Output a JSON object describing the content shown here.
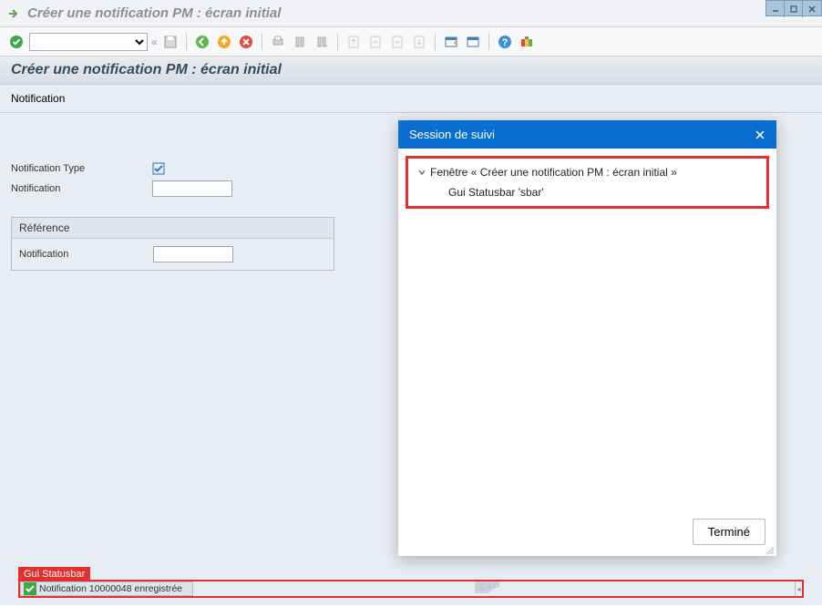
{
  "window": {
    "title": "Créer une notification PM : écran initial"
  },
  "page": {
    "header_title": "Créer une notification PM : écran initial",
    "tab_label": "Notification"
  },
  "form": {
    "type_label": "Notification  Type",
    "notification_label": "Notification",
    "notification_value": ""
  },
  "reference_group": {
    "title": "Référence",
    "notification_label": "Notification",
    "notification_value": ""
  },
  "popup": {
    "title": "Session de suivi",
    "tree_root": "Fenêtre « Créer une notification PM : écran initial »",
    "tree_child": "Gui Statusbar 'sbar'",
    "done_label": "Terminé"
  },
  "statusbar": {
    "badge": "Gui Statusbar",
    "message": "Notification 10000048 enregistrée",
    "logo": "SAP"
  }
}
